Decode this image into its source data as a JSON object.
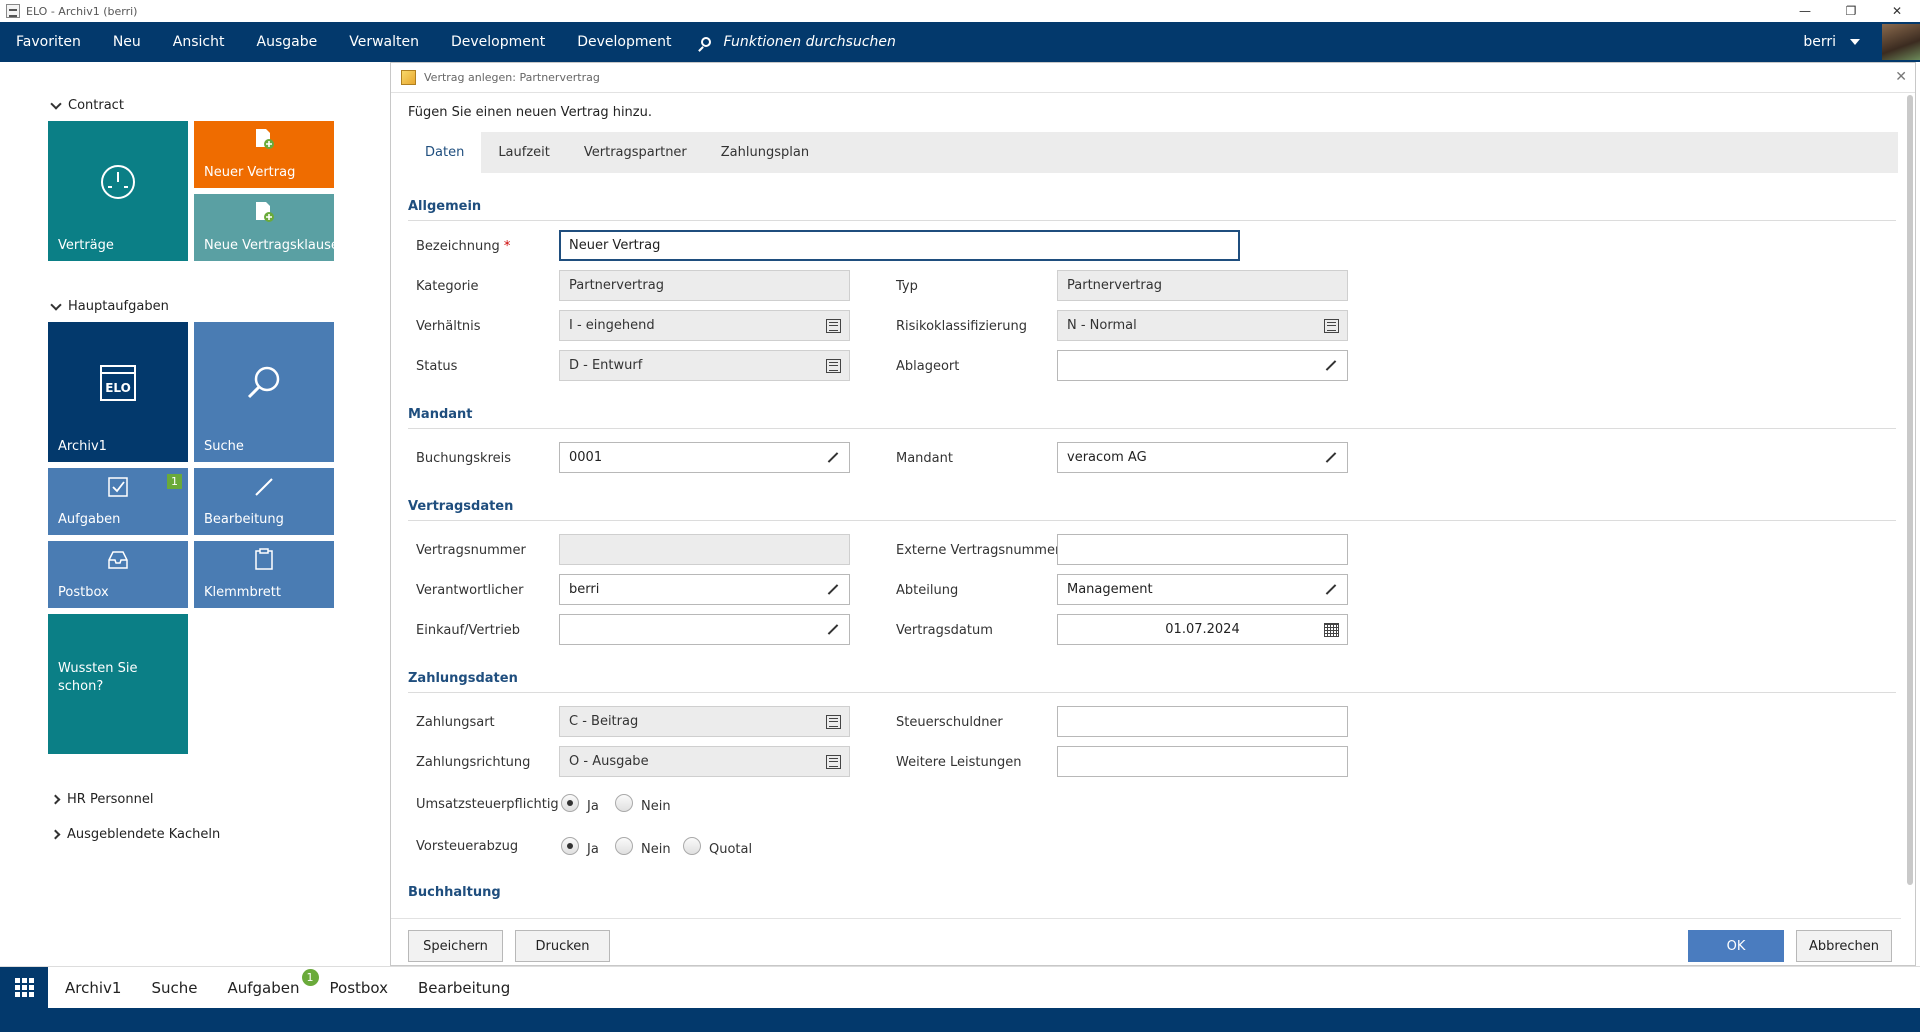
{
  "window": {
    "title": "ELO - Archiv1 (berri)",
    "controls": [
      "—",
      "❐",
      "✕"
    ]
  },
  "menubar": {
    "items": [
      "Favoriten",
      "Neu",
      "Ansicht",
      "Ausgabe",
      "Verwalten",
      "Development",
      "Development"
    ],
    "search_label": "Funktionen durchsuchen",
    "user": "berri"
  },
  "sidebar": {
    "groups": {
      "contract": "Contract",
      "hauptaufgaben": "Hauptaufgaben",
      "hr": "HR Personnel",
      "hidden": "Ausgeblendete Kacheln"
    },
    "tiles": {
      "vertraege": "Verträge",
      "neuer_vertrag": "Neuer Vertrag",
      "neue_klausel": "Neue Vertragsklausel",
      "archiv": "Archiv1",
      "suche": "Suche",
      "aufgaben": "Aufgaben",
      "aufgaben_badge": "1",
      "bearbeitung": "Bearbeitung",
      "postbox": "Postbox",
      "klemmbrett": "Klemmbrett",
      "wussten": "Wussten Sie schon?"
    },
    "colors": {
      "teal": "#0b7f86",
      "orange": "#ef6c00",
      "teal_light": "#5aa0a3",
      "navy": "#03396c",
      "blue": "#4a7cb3"
    }
  },
  "taskbar": {
    "items": [
      "Archiv1",
      "Suche",
      "Aufgaben",
      "Postbox",
      "Bearbeitung"
    ],
    "aufgaben_badge": "1"
  },
  "dialog": {
    "title": "Vertrag anlegen: Partnervertrag",
    "subtitle": "Fügen Sie einen neuen Vertrag hinzu.",
    "tabs": [
      "Daten",
      "Laufzeit",
      "Vertragspartner",
      "Zahlungsplan"
    ],
    "sections": {
      "allgemein": "Allgemein",
      "mandant": "Mandant",
      "vertragsdaten": "Vertragsdaten",
      "zahlungsdaten": "Zahlungsdaten",
      "buchhaltung": "Buchhaltung"
    },
    "fields": {
      "bezeichnung": {
        "label": "Bezeichnung",
        "value": "Neuer Vertrag"
      },
      "kategorie": {
        "label": "Kategorie",
        "value": "Partnervertrag"
      },
      "typ": {
        "label": "Typ",
        "value": "Partnervertrag"
      },
      "verhaeltnis": {
        "label": "Verhältnis",
        "value": "I - eingehend"
      },
      "risiko": {
        "label": "Risikoklassifizierung",
        "value": "N - Normal"
      },
      "status": {
        "label": "Status",
        "value": "D - Entwurf"
      },
      "ablageort": {
        "label": "Ablageort",
        "value": ""
      },
      "buchungskreis": {
        "label": "Buchungskreis",
        "value": "0001"
      },
      "mandant": {
        "label": "Mandant",
        "value": "veracom AG"
      },
      "vertragsnummer": {
        "label": "Vertragsnummer",
        "value": ""
      },
      "extern": {
        "label": "Externe Vertragsnummer",
        "value": ""
      },
      "verantwortlicher": {
        "label": "Verantwortlicher",
        "value": "berri"
      },
      "abteilung": {
        "label": "Abteilung",
        "value": "Management"
      },
      "einkauf": {
        "label": "Einkauf/Vertrieb",
        "value": ""
      },
      "vertragsdatum": {
        "label": "Vertragsdatum",
        "value": "01.07.2024"
      },
      "zahlungsart": {
        "label": "Zahlungsart",
        "value": "C - Beitrag"
      },
      "steuerschuldner": {
        "label": "Steuerschuldner",
        "value": ""
      },
      "zahlungsrichtung": {
        "label": "Zahlungsrichtung",
        "value": "O - Ausgabe"
      },
      "weitere": {
        "label": "Weitere Leistungen",
        "value": ""
      },
      "ust": {
        "label": "Umsatzsteuerpflichtig",
        "options": [
          "Ja",
          "Nein"
        ],
        "selected": "Ja"
      },
      "vorsteuer": {
        "label": "Vorsteuerabzug",
        "options": [
          "Ja",
          "Nein",
          "Quotal"
        ],
        "selected": "Ja"
      }
    },
    "buttons": {
      "save": "Speichern",
      "print": "Drucken",
      "ok": "OK",
      "cancel": "Abbrechen"
    }
  }
}
